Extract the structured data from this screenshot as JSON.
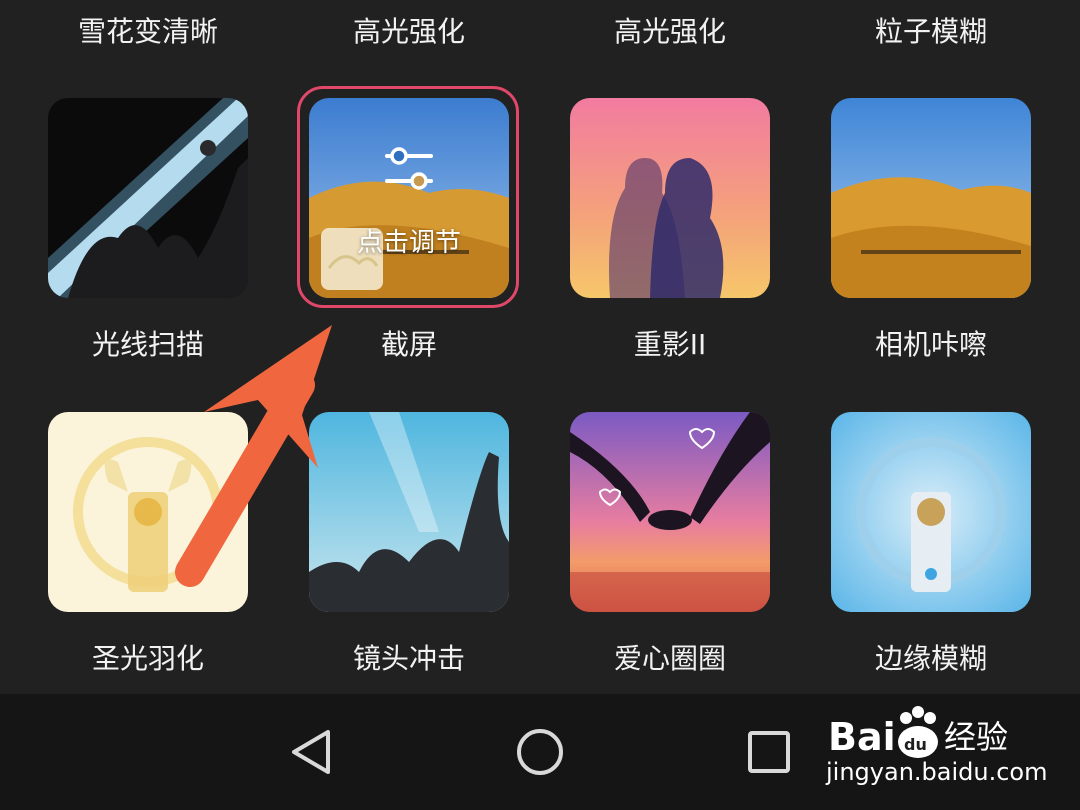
{
  "top_row_labels": [
    "雪花变清晰",
    "高光强化",
    "高光强化",
    "粒子模糊"
  ],
  "effects": [
    {
      "label": "光线扫描"
    },
    {
      "label": "截屏",
      "selected": true,
      "overlay_label": "点击调节"
    },
    {
      "label": "重影II"
    },
    {
      "label": "相机咔嚓"
    },
    {
      "label": "圣光羽化"
    },
    {
      "label": "镜头冲击"
    },
    {
      "label": "爱心圈圈"
    },
    {
      "label": "边缘模糊"
    }
  ],
  "colors": {
    "accent_ring": "#e0486a",
    "arrow": "#f0663f",
    "background": "#212121"
  },
  "navbar": {
    "icons": [
      "back-triangle-icon",
      "home-circle-icon",
      "recents-square-icon"
    ]
  },
  "watermark": {
    "brand": "Baidu经验",
    "domain": "jingyan.baidu.com"
  }
}
